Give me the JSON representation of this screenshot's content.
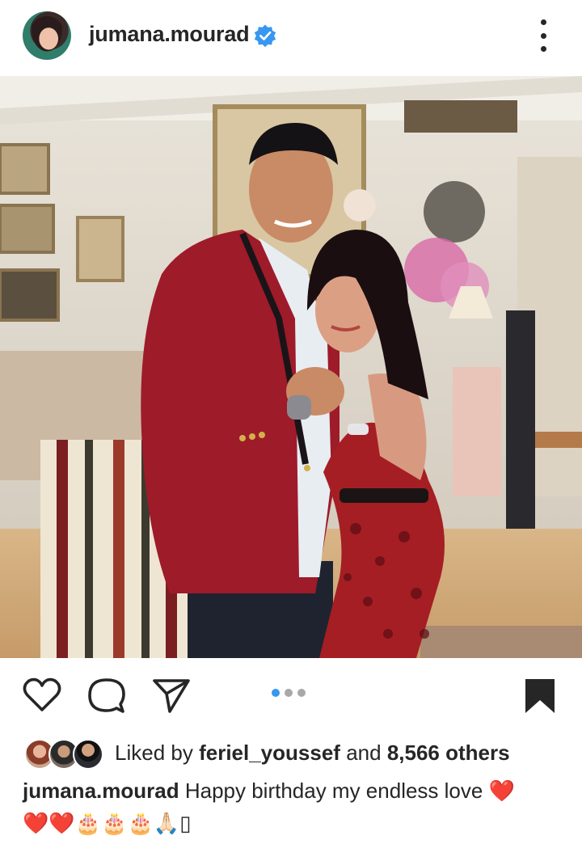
{
  "post": {
    "username": "jumana.mourad",
    "verified": true,
    "carousel": {
      "count": 3,
      "active_index": 0
    },
    "likes": {
      "prefix": "Liked by",
      "user": "feriel_youssef",
      "and": "and",
      "count": "8,566 others"
    },
    "caption": {
      "username": "jumana.mourad",
      "text": "Happy birthday my endless love ❤️",
      "emoji_line": "❤️❤️🎂🎂🎂🙏🏻",
      "trailing_glyph": "▯"
    }
  },
  "icons": {
    "verified": "verified-badge-icon",
    "more": "more-options-icon",
    "like": "heart-icon",
    "comment": "comment-icon",
    "share": "send-icon",
    "save": "bookmark-icon"
  },
  "colors": {
    "accent_blue": "#3897f0",
    "text": "#262626",
    "heart_red": "#e0242f",
    "dot_inactive": "#a8a8a8"
  }
}
